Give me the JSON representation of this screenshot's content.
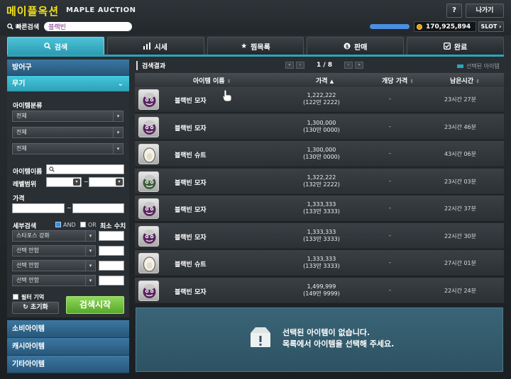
{
  "header": {
    "logo": "메이플옥션",
    "logo_sub": "MAPLE AUCTION",
    "quick_search_label": "빠른검색",
    "quick_search_value": "블랙빈",
    "help_label": "?",
    "exit_label": "나가기",
    "meso": "170,925,894",
    "slot_label": "SLOT"
  },
  "tabs": [
    {
      "label": "검색",
      "icon": "search-icon"
    },
    {
      "label": "시세",
      "icon": "bar-chart-icon"
    },
    {
      "label": "찜목록",
      "icon": "star-icon"
    },
    {
      "label": "판매",
      "icon": "coin-icon"
    },
    {
      "label": "완료",
      "icon": "check-box-icon"
    }
  ],
  "sidebar": {
    "categories_top": [
      "방어구",
      "무기"
    ],
    "category_label": "아이템분류",
    "category_selects": [
      "전체",
      "전체",
      "전체"
    ],
    "item_name_label": "아이템이름",
    "level_range_label": "레벨범위",
    "level_dash": "~",
    "price_label": "가격",
    "price_dash": "~",
    "detail_search_label": "세부검색",
    "and_label": "AND",
    "or_label": "OR",
    "min_value_label": "최소 수치",
    "detail_selects": [
      "스타포스 강화",
      "선택 안함",
      "선택 안함",
      "선택 안함"
    ],
    "remember_filter_label": "필터 기억",
    "reset_label": "초기화",
    "search_button_label": "검색시작",
    "categories_bottom": [
      "소비아이템",
      "캐시아이템",
      "기타아이템"
    ]
  },
  "results": {
    "title": "검색결과",
    "page_info": "1 / 8",
    "selected_legend": "선택된 아이템",
    "columns": {
      "name": "아이템 이름",
      "price": "가격",
      "unit_price": "개당 가격",
      "time_left": "남은시간"
    },
    "rows": [
      {
        "name": "블랙빈 모자",
        "price": "1,222,222",
        "price_sub": "(122만 2222)",
        "unit_price": "-",
        "time_left": "23시간 27분",
        "thumb": "hat"
      },
      {
        "name": "블랙빈 모자",
        "price": "1,300,000",
        "price_sub": "(130만 0000)",
        "unit_price": "-",
        "time_left": "23시간 46분",
        "thumb": "hat"
      },
      {
        "name": "블랙빈 슈트",
        "price": "1,300,000",
        "price_sub": "(130만 0000)",
        "unit_price": "-",
        "time_left": "43시간 06분",
        "thumb": "suit"
      },
      {
        "name": "블랙빈 모자",
        "price": "1,322,222",
        "price_sub": "(132만 2222)",
        "unit_price": "-",
        "time_left": "23시간 03분",
        "thumb": "hat-green"
      },
      {
        "name": "블랙빈 모자",
        "price": "1,333,333",
        "price_sub": "(133만 3333)",
        "unit_price": "-",
        "time_left": "22시간 37분",
        "thumb": "hat"
      },
      {
        "name": "블랙빈 모자",
        "price": "1,333,333",
        "price_sub": "(133만 3333)",
        "unit_price": "-",
        "time_left": "22시간 30분",
        "thumb": "hat"
      },
      {
        "name": "블랙빈 슈트",
        "price": "1,333,333",
        "price_sub": "(133만 3333)",
        "unit_price": "-",
        "time_left": "27시간 01분",
        "thumb": "suit"
      },
      {
        "name": "블랙빈 모자",
        "price": "1,499,999",
        "price_sub": "(149만 9999)",
        "unit_price": "-",
        "time_left": "22시간 24분",
        "thumb": "hat"
      }
    ]
  },
  "detail": {
    "message_line1": "선택된 아이템이 없습니다.",
    "message_line2": "목록에서 아이템을 선택해 주세요."
  },
  "colors": {
    "accent": "#2ea4bc",
    "logo": "#f3e21a",
    "search_button": "#58a82a"
  }
}
